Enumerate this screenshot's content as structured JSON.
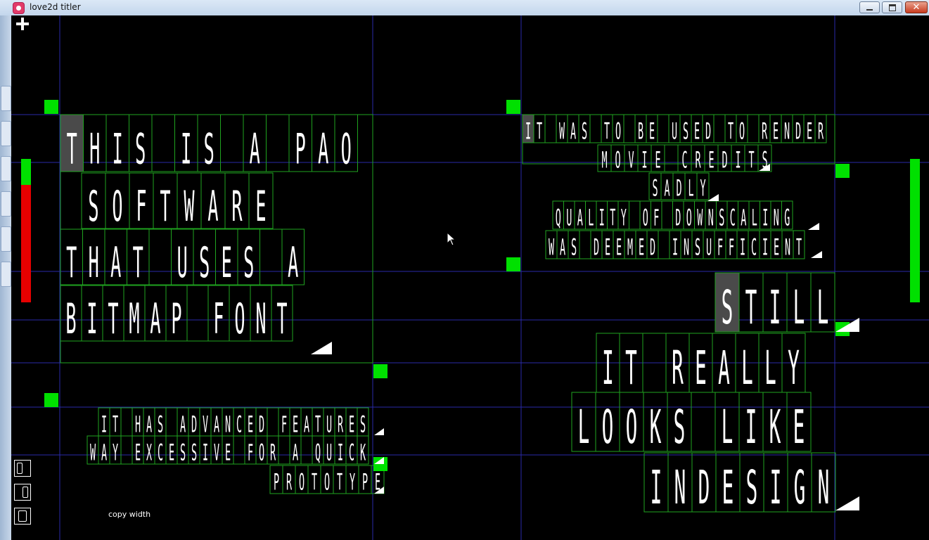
{
  "window": {
    "title": "love2d titler"
  },
  "toolbar": {
    "add_label": "+",
    "copy_width_label": "copy width",
    "align_buttons": [
      "align-left",
      "align-right",
      "align-justify"
    ]
  },
  "colors": {
    "background": "#000000",
    "guide": "#2a2aa8",
    "cell_border": "#1fa31f",
    "handle": "#00e000",
    "text": "#ffffff",
    "meter_red": "#e60000",
    "meter_green": "#00e000",
    "highlight": "#4a4a4a"
  },
  "left_meter": {
    "level": 0.18
  },
  "right_meter": {
    "level": 1.0
  },
  "blocks": [
    {
      "id": "block-1",
      "lines": [
        "THIS IS A PAO",
        "SOFTWARE",
        "THAT USES A",
        "BITMAP FONT"
      ]
    },
    {
      "id": "block-2",
      "lines": [
        "IT WAS TO BE USED TO RENDER",
        "MOVIE CREDITS",
        "SADLY",
        "QUALITY OF DOWNSCALING",
        "WAS DEEMED INSUFFICIENT"
      ]
    },
    {
      "id": "block-3",
      "lines": [
        "IT HAS ADVANCED FEATURES",
        "WAY EXCESSIVE FOR A QUICK",
        "PROTOTYPE"
      ]
    },
    {
      "id": "block-4",
      "lines": [
        "STILL",
        "IT REALLY",
        "LOOKS LIKE",
        "INDESIGN"
      ]
    }
  ]
}
